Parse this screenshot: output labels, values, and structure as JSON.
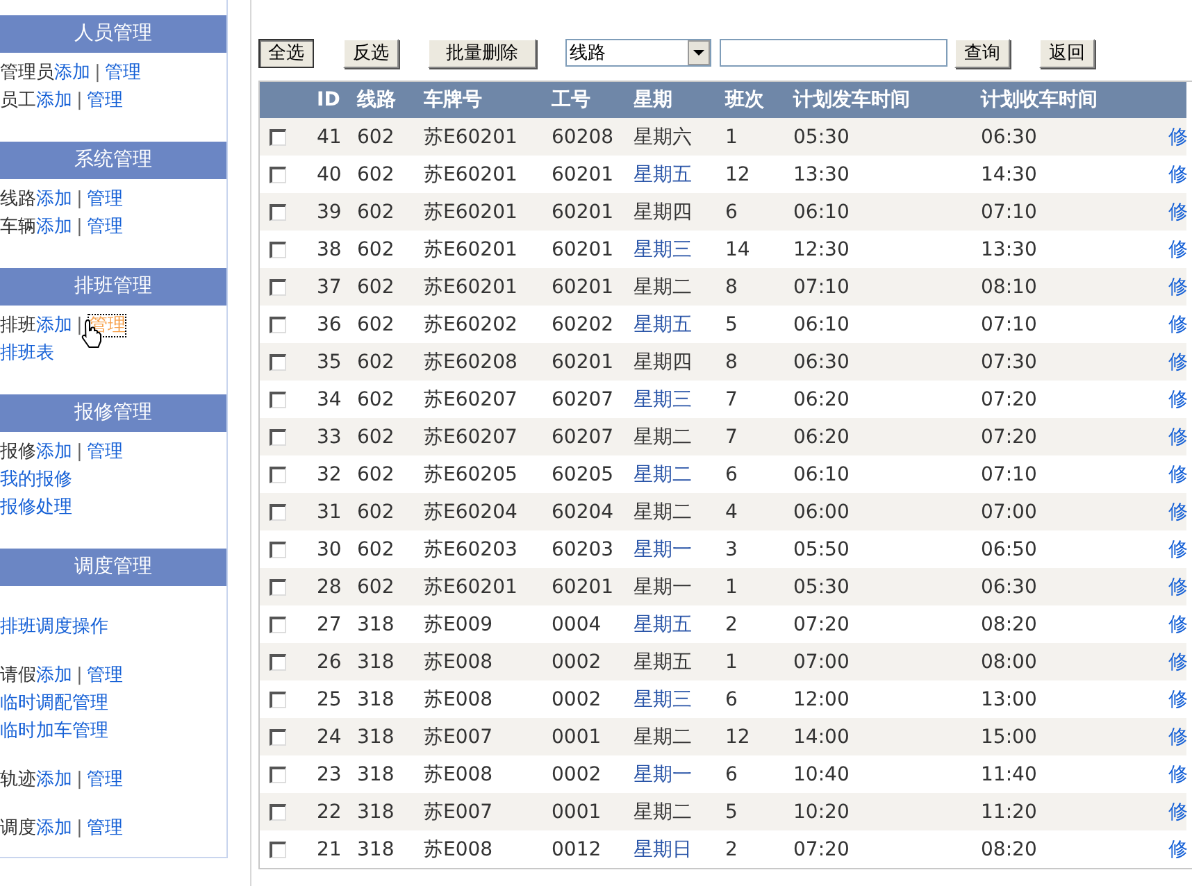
{
  "sidebar": {
    "sections": [
      {
        "title": "人员管理",
        "groups": [
          [
            {
              "label": "管理员",
              "links": [
                {
                  "text": "添加",
                  "hovered": false
                },
                {
                  "text": "管理",
                  "hovered": false
                }
              ],
              "separator": "|"
            },
            {
              "label": "员工",
              "links": [
                {
                  "text": "添加",
                  "hovered": false
                },
                {
                  "text": "管理",
                  "hovered": false
                }
              ],
              "separator": "|"
            }
          ]
        ]
      },
      {
        "title": "系统管理",
        "groups": [
          [
            {
              "label": "线路",
              "links": [
                {
                  "text": "添加",
                  "hovered": false
                },
                {
                  "text": "管理",
                  "hovered": false
                }
              ],
              "separator": "|"
            },
            {
              "label": "车辆",
              "links": [
                {
                  "text": "添加",
                  "hovered": false
                },
                {
                  "text": "管理",
                  "hovered": false
                }
              ],
              "separator": "|"
            }
          ]
        ]
      },
      {
        "title": "排班管理",
        "groups": [
          [
            {
              "label": "排班",
              "links": [
                {
                  "text": "添加",
                  "hovered": false
                },
                {
                  "text": "管理",
                  "hovered": true
                }
              ],
              "separator": "|"
            },
            {
              "links": [
                {
                  "text": "排班表",
                  "hovered": false
                }
              ]
            }
          ]
        ]
      },
      {
        "title": "报修管理",
        "groups": [
          [
            {
              "label": "报修",
              "links": [
                {
                  "text": "添加",
                  "hovered": false
                },
                {
                  "text": "管理",
                  "hovered": false
                }
              ],
              "separator": "|"
            },
            {
              "links": [
                {
                  "text": "我的报修",
                  "hovered": false
                }
              ]
            },
            {
              "links": [
                {
                  "text": "报修处理",
                  "hovered": false
                }
              ]
            }
          ]
        ]
      },
      {
        "title": "调度管理",
        "groups": [
          [
            {
              "links": [
                {
                  "text": "排班调度操作",
                  "hovered": false
                }
              ]
            }
          ],
          [
            {
              "label": "请假",
              "links": [
                {
                  "text": "添加",
                  "hovered": false
                },
                {
                  "text": "管理",
                  "hovered": false
                }
              ],
              "separator": "|"
            },
            {
              "links": [
                {
                  "text": "临时调配管理",
                  "hovered": false
                }
              ]
            },
            {
              "links": [
                {
                  "text": "临时加车管理",
                  "hovered": false
                }
              ]
            }
          ],
          [
            {
              "label": "轨迹",
              "links": [
                {
                  "text": "添加",
                  "hovered": false
                },
                {
                  "text": "管理",
                  "hovered": false
                }
              ],
              "separator": "|"
            }
          ],
          [
            {
              "label": "调度",
              "links": [
                {
                  "text": "添加",
                  "hovered": false
                },
                {
                  "text": "管理",
                  "hovered": false
                }
              ],
              "separator": "|"
            }
          ]
        ]
      }
    ]
  },
  "toolbar": {
    "select_all": "全选",
    "invert": "反选",
    "batch_delete": "批量删除",
    "field_select": {
      "value": "线路"
    },
    "query": "查询",
    "back": "返回"
  },
  "table": {
    "columns": [
      "ID",
      "线路",
      "车牌号",
      "工号",
      "星期",
      "班次",
      "计划发车时间",
      "计划收车时间"
    ],
    "rows": [
      {
        "checked": false,
        "cells": [
          "41",
          "602",
          "苏E60201",
          "60208",
          "星期六",
          "1",
          "05:30",
          "06:30"
        ],
        "action": "修"
      },
      {
        "checked": false,
        "cells": [
          "40",
          "602",
          "苏E60201",
          "60201",
          "星期五",
          "12",
          "13:30",
          "14:30"
        ],
        "action": "修"
      },
      {
        "checked": false,
        "cells": [
          "39",
          "602",
          "苏E60201",
          "60201",
          "星期四",
          "6",
          "06:10",
          "07:10"
        ],
        "action": "修"
      },
      {
        "checked": false,
        "cells": [
          "38",
          "602",
          "苏E60201",
          "60201",
          "星期三",
          "14",
          "12:30",
          "13:30"
        ],
        "action": "修"
      },
      {
        "checked": false,
        "cells": [
          "37",
          "602",
          "苏E60201",
          "60201",
          "星期二",
          "8",
          "07:10",
          "08:10"
        ],
        "action": "修"
      },
      {
        "checked": false,
        "cells": [
          "36",
          "602",
          "苏E60202",
          "60202",
          "星期五",
          "5",
          "06:10",
          "07:10"
        ],
        "action": "修"
      },
      {
        "checked": false,
        "cells": [
          "35",
          "602",
          "苏E60208",
          "60201",
          "星期四",
          "8",
          "06:30",
          "07:30"
        ],
        "action": "修"
      },
      {
        "checked": false,
        "cells": [
          "34",
          "602",
          "苏E60207",
          "60207",
          "星期三",
          "7",
          "06:20",
          "07:20"
        ],
        "action": "修"
      },
      {
        "checked": false,
        "cells": [
          "33",
          "602",
          "苏E60207",
          "60207",
          "星期二",
          "7",
          "06:20",
          "07:20"
        ],
        "action": "修"
      },
      {
        "checked": false,
        "cells": [
          "32",
          "602",
          "苏E60205",
          "60205",
          "星期二",
          "6",
          "06:10",
          "07:10"
        ],
        "action": "修"
      },
      {
        "checked": false,
        "cells": [
          "31",
          "602",
          "苏E60204",
          "60204",
          "星期二",
          "4",
          "06:00",
          "07:00"
        ],
        "action": "修"
      },
      {
        "checked": false,
        "cells": [
          "30",
          "602",
          "苏E60203",
          "60203",
          "星期一",
          "3",
          "05:50",
          "06:50"
        ],
        "action": "修"
      },
      {
        "checked": false,
        "cells": [
          "28",
          "602",
          "苏E60201",
          "60201",
          "星期一",
          "1",
          "05:30",
          "06:30"
        ],
        "action": "修"
      },
      {
        "checked": false,
        "cells": [
          "27",
          "318",
          "苏E009",
          "0004",
          "星期五",
          "2",
          "07:20",
          "08:20"
        ],
        "action": "修"
      },
      {
        "checked": false,
        "cells": [
          "26",
          "318",
          "苏E008",
          "0002",
          "星期五",
          "1",
          "07:00",
          "08:00"
        ],
        "action": "修"
      },
      {
        "checked": false,
        "cells": [
          "25",
          "318",
          "苏E008",
          "0002",
          "星期三",
          "6",
          "12:00",
          "13:00"
        ],
        "action": "修"
      },
      {
        "checked": false,
        "cells": [
          "24",
          "318",
          "苏E007",
          "0001",
          "星期二",
          "12",
          "14:00",
          "15:00"
        ],
        "action": "修"
      },
      {
        "checked": false,
        "cells": [
          "23",
          "318",
          "苏E008",
          "0002",
          "星期一",
          "6",
          "10:40",
          "11:40"
        ],
        "action": "修"
      },
      {
        "checked": false,
        "cells": [
          "22",
          "318",
          "苏E007",
          "0001",
          "星期二",
          "5",
          "10:20",
          "11:20"
        ],
        "action": "修"
      },
      {
        "checked": false,
        "cells": [
          "21",
          "318",
          "苏E008",
          "0012",
          "星期日",
          "2",
          "07:20",
          "08:20"
        ],
        "action": "修"
      }
    ]
  }
}
